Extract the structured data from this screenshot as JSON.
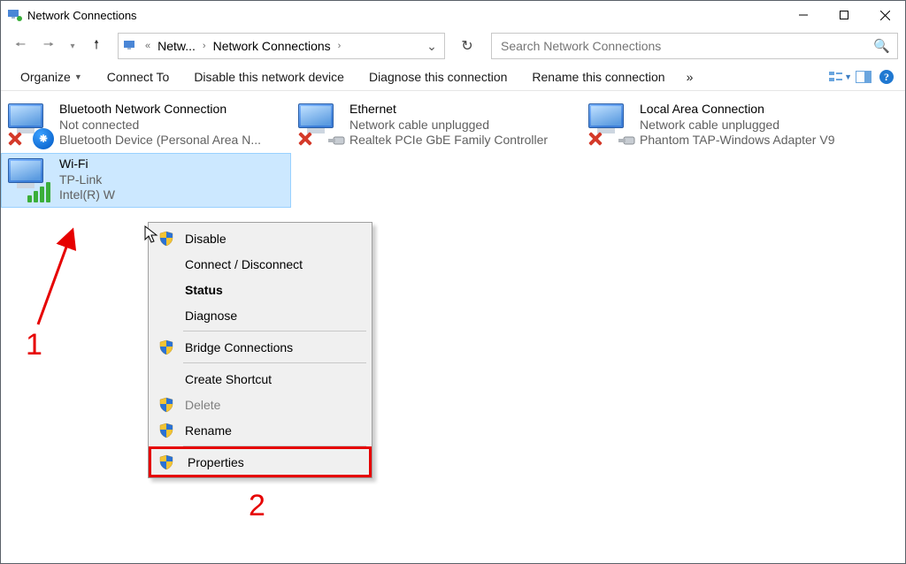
{
  "window": {
    "title": "Network Connections"
  },
  "breadcrumb": {
    "seg1": "Netw...",
    "seg2": "Network Connections"
  },
  "search": {
    "placeholder": "Search Network Connections"
  },
  "toolbar": {
    "organize": "Organize",
    "connect_to": "Connect To",
    "disable": "Disable this network device",
    "diagnose": "Diagnose this connection",
    "rename": "Rename this connection"
  },
  "connections": [
    {
      "name": "Bluetooth Network Connection",
      "status": "Not connected",
      "device": "Bluetooth Device (Personal Area N..."
    },
    {
      "name": "Ethernet",
      "status": "Network cable unplugged",
      "device": "Realtek PCIe GbE Family Controller"
    },
    {
      "name": "Local Area Connection",
      "status": "Network cable unplugged",
      "device": "Phantom TAP-Windows Adapter V9"
    },
    {
      "name": "Wi-Fi",
      "status": "TP-Link",
      "device": "Intel(R) W"
    }
  ],
  "context_menu": {
    "disable": "Disable",
    "connect_disconnect": "Connect / Disconnect",
    "status": "Status",
    "diagnose": "Diagnose",
    "bridge": "Bridge Connections",
    "create_shortcut": "Create Shortcut",
    "delete": "Delete",
    "rename": "Rename",
    "properties": "Properties"
  },
  "annotations": {
    "one": "1",
    "two": "2"
  }
}
